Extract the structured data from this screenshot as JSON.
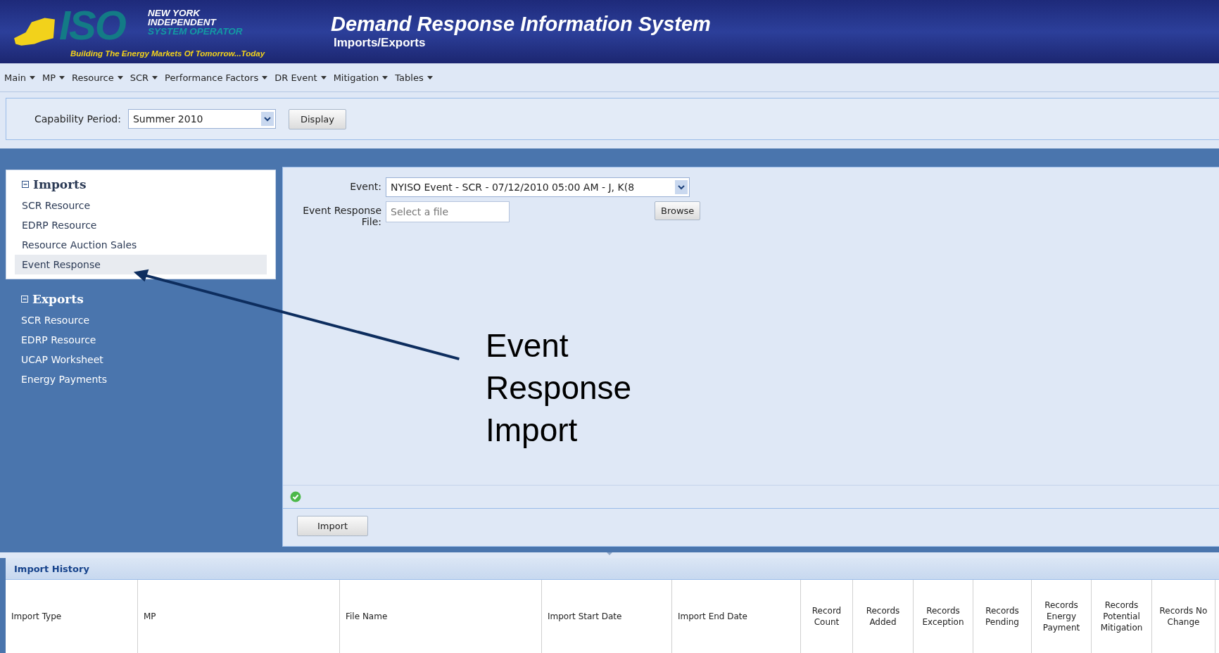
{
  "header": {
    "logo": {
      "letters": "ISO",
      "lines": [
        "NEW YORK",
        "INDEPENDENT",
        "SYSTEM OPERATOR"
      ],
      "tagline": "Building The Energy Markets Of Tomorrow...Today"
    },
    "title": "Demand Response Information System",
    "subtitle": "Imports/Exports"
  },
  "menu": [
    "Main",
    "MP",
    "Resource",
    "SCR",
    "Performance Factors",
    "DR Event",
    "Mitigation",
    "Tables"
  ],
  "toolbar": {
    "label": "Capability Period:",
    "value": "Summer 2010",
    "button": "Display"
  },
  "sidebar": [
    {
      "title": "Imports",
      "expanded": true,
      "active": true,
      "items": [
        {
          "label": "SCR Resource",
          "selected": false
        },
        {
          "label": "EDRP Resource",
          "selected": false
        },
        {
          "label": "Resource Auction Sales",
          "selected": false
        },
        {
          "label": "Event Response",
          "selected": true
        }
      ]
    },
    {
      "title": "Exports",
      "expanded": true,
      "active": false,
      "items": [
        {
          "label": "SCR Resource",
          "selected": false
        },
        {
          "label": "EDRP Resource",
          "selected": false
        },
        {
          "label": "UCAP Worksheet",
          "selected": false
        },
        {
          "label": "Energy Payments",
          "selected": false
        }
      ]
    }
  ],
  "form": {
    "event_label": "Event:",
    "event_value": "NYISO Event - SCR - 07/12/2010 05:00 AM - J, K(8",
    "file_label": "Event Response File:",
    "file_placeholder": "Select a file",
    "browse_button": "Browse",
    "import_button": "Import"
  },
  "annotation": "Event Response Import",
  "history": {
    "title": "Import History",
    "columns": [
      "Import Type",
      "MP",
      "File Name",
      "Import Start Date",
      "Import End Date",
      "Record Count",
      "Records Added",
      "Records Exception",
      "Records Pending",
      "Records Energy Payment",
      "Records Potential Mitigation",
      "Records No Change"
    ]
  }
}
